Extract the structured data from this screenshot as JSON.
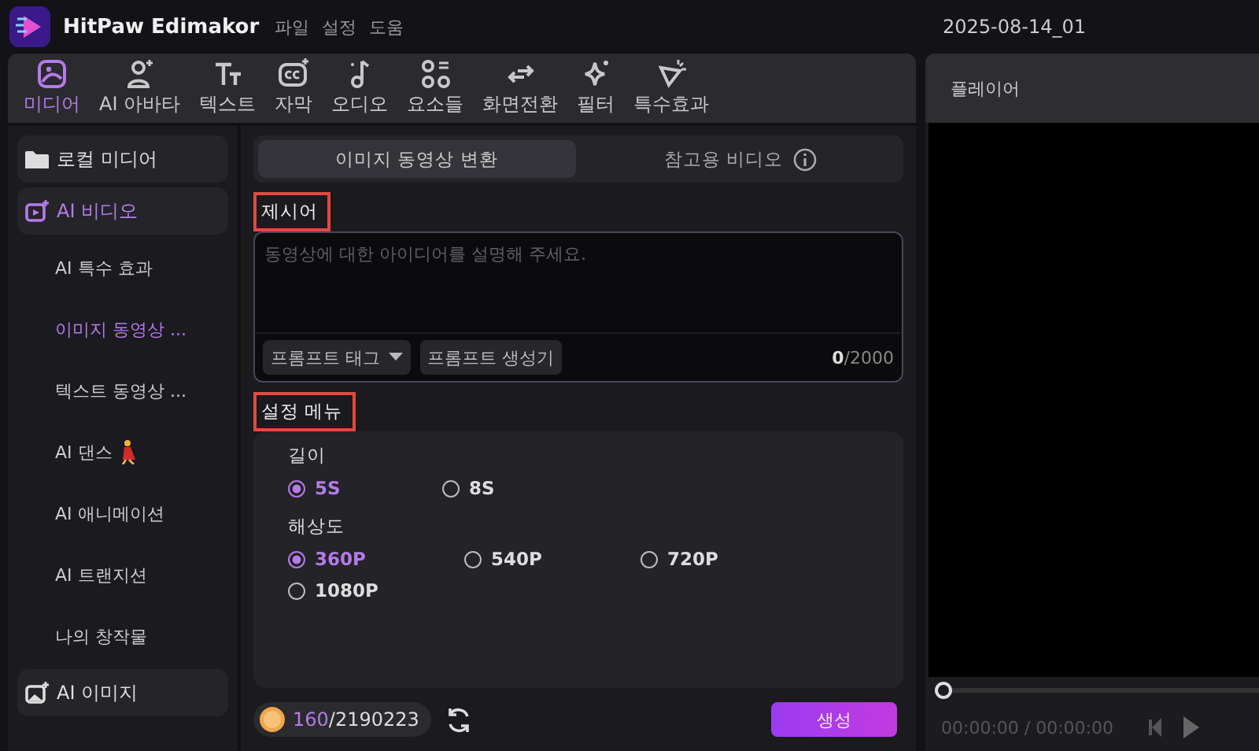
{
  "app": {
    "name": "HitPaw Edimakor",
    "menu": [
      "파일",
      "설정",
      "도움"
    ],
    "project": "2025-08-14_01"
  },
  "toolbar": [
    {
      "label": "미디어",
      "selected": true
    },
    {
      "label": "AI 아바타",
      "selected": false
    },
    {
      "label": "텍스트",
      "selected": false
    },
    {
      "label": "자막",
      "selected": false
    },
    {
      "label": "오디오",
      "selected": false
    },
    {
      "label": "요소들",
      "selected": false
    },
    {
      "label": "화면전환",
      "selected": false
    },
    {
      "label": "필터",
      "selected": false
    },
    {
      "label": "특수효과",
      "selected": false
    }
  ],
  "sidebar": {
    "items": [
      {
        "kind": "category",
        "label": "로컬 미디어",
        "selected": false
      },
      {
        "kind": "category",
        "label": "AI 비디오",
        "selected": true
      },
      {
        "kind": "sub",
        "label": "AI 특수 효과",
        "selected": false
      },
      {
        "kind": "sub",
        "label": "이미지 동영상 ...",
        "selected": true
      },
      {
        "kind": "sub",
        "label": "텍스트 동영상 ...",
        "selected": false
      },
      {
        "kind": "sub",
        "label": "AI 댄스",
        "selected": false,
        "emoji": true
      },
      {
        "kind": "sub",
        "label": "AI 애니메이션",
        "selected": false
      },
      {
        "kind": "sub",
        "label": "AI 트랜지션",
        "selected": false
      },
      {
        "kind": "sub",
        "label": "나의 창작물",
        "selected": false
      },
      {
        "kind": "category",
        "label": "AI 이미지",
        "selected": false
      }
    ]
  },
  "mode_tabs": [
    {
      "label": "이미지 동영상 변환",
      "selected": true,
      "info": false
    },
    {
      "label": "참고용 비디오",
      "selected": false,
      "info": true
    }
  ],
  "prompt": {
    "label": "제시어",
    "highlighted": true,
    "placeholder": "동영상에 대한 아이디어를 설명해 주세요.",
    "tag_button": "프롬프트 태그",
    "generator_button": "프롬프트 생성기",
    "count": "0",
    "limit": "/2000"
  },
  "settings": {
    "label": "설정 메뉴",
    "highlighted": true,
    "groups": [
      {
        "label": "길이",
        "options": [
          {
            "label": "5S",
            "selected": true
          },
          {
            "label": "8S",
            "selected": false
          }
        ]
      },
      {
        "label": "해상도",
        "options": [
          {
            "label": "360P",
            "selected": true
          },
          {
            "label": "540P",
            "selected": false
          },
          {
            "label": "720P",
            "selected": false
          },
          {
            "label": "1080P",
            "selected": false
          }
        ]
      }
    ]
  },
  "footer": {
    "credits_used": "160",
    "credits_total": "/2190223",
    "generate_button": "생성"
  },
  "player": {
    "title": "플레이어",
    "progress": {
      "level": 0
    },
    "current_time": "00:00:00",
    "total_time": " / 00:00:00"
  }
}
